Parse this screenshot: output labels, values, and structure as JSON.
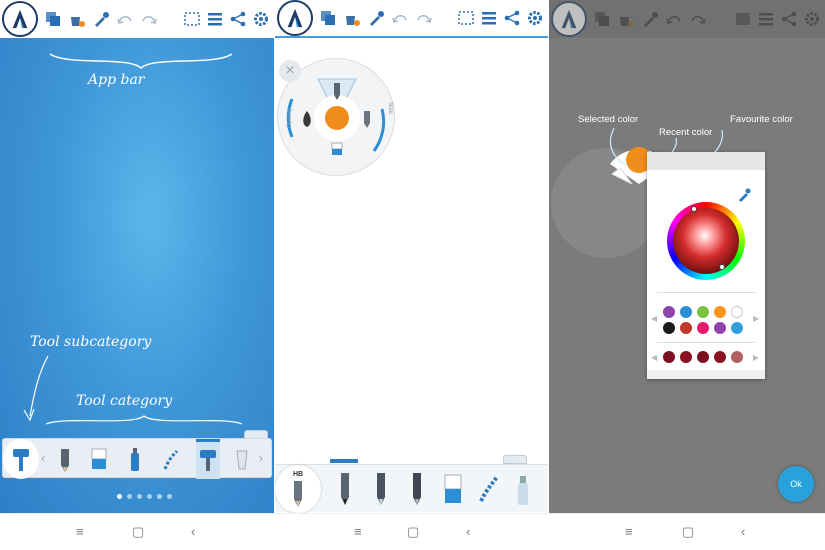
{
  "panel1": {
    "callouts": {
      "app_bar": "App bar",
      "tool_subcategory": "Tool subcategory",
      "tool_category": "Tool category"
    },
    "page_dots": 6,
    "active_dot": 0
  },
  "panel2": {
    "tool_label": "HB",
    "radial_labels": {
      "left": "Opacity",
      "right": "Size"
    },
    "selected_color": "#f08c1a"
  },
  "panel3": {
    "labels": {
      "selected_color": "Selected color",
      "recent_color": "Recent color",
      "favourite_color": "Favourite color"
    },
    "ok_label": "Ok",
    "recent_colors": [
      [
        "#8e44ad",
        "#2c8fd6",
        "#7cc242",
        "#f7941d",
        "#ffffff"
      ],
      [
        "#1a1a1a",
        "#c0392b",
        "#e6196b",
        "#8e44ad",
        "#2fa0dc"
      ]
    ],
    "favourite_colors": [
      "#7a1020",
      "#8c1222",
      "#7a1020",
      "#8c1222",
      "#b06060"
    ]
  },
  "colors": {
    "accent_blue": "#2a7cc4",
    "brand_navy": "#1f3b68"
  }
}
